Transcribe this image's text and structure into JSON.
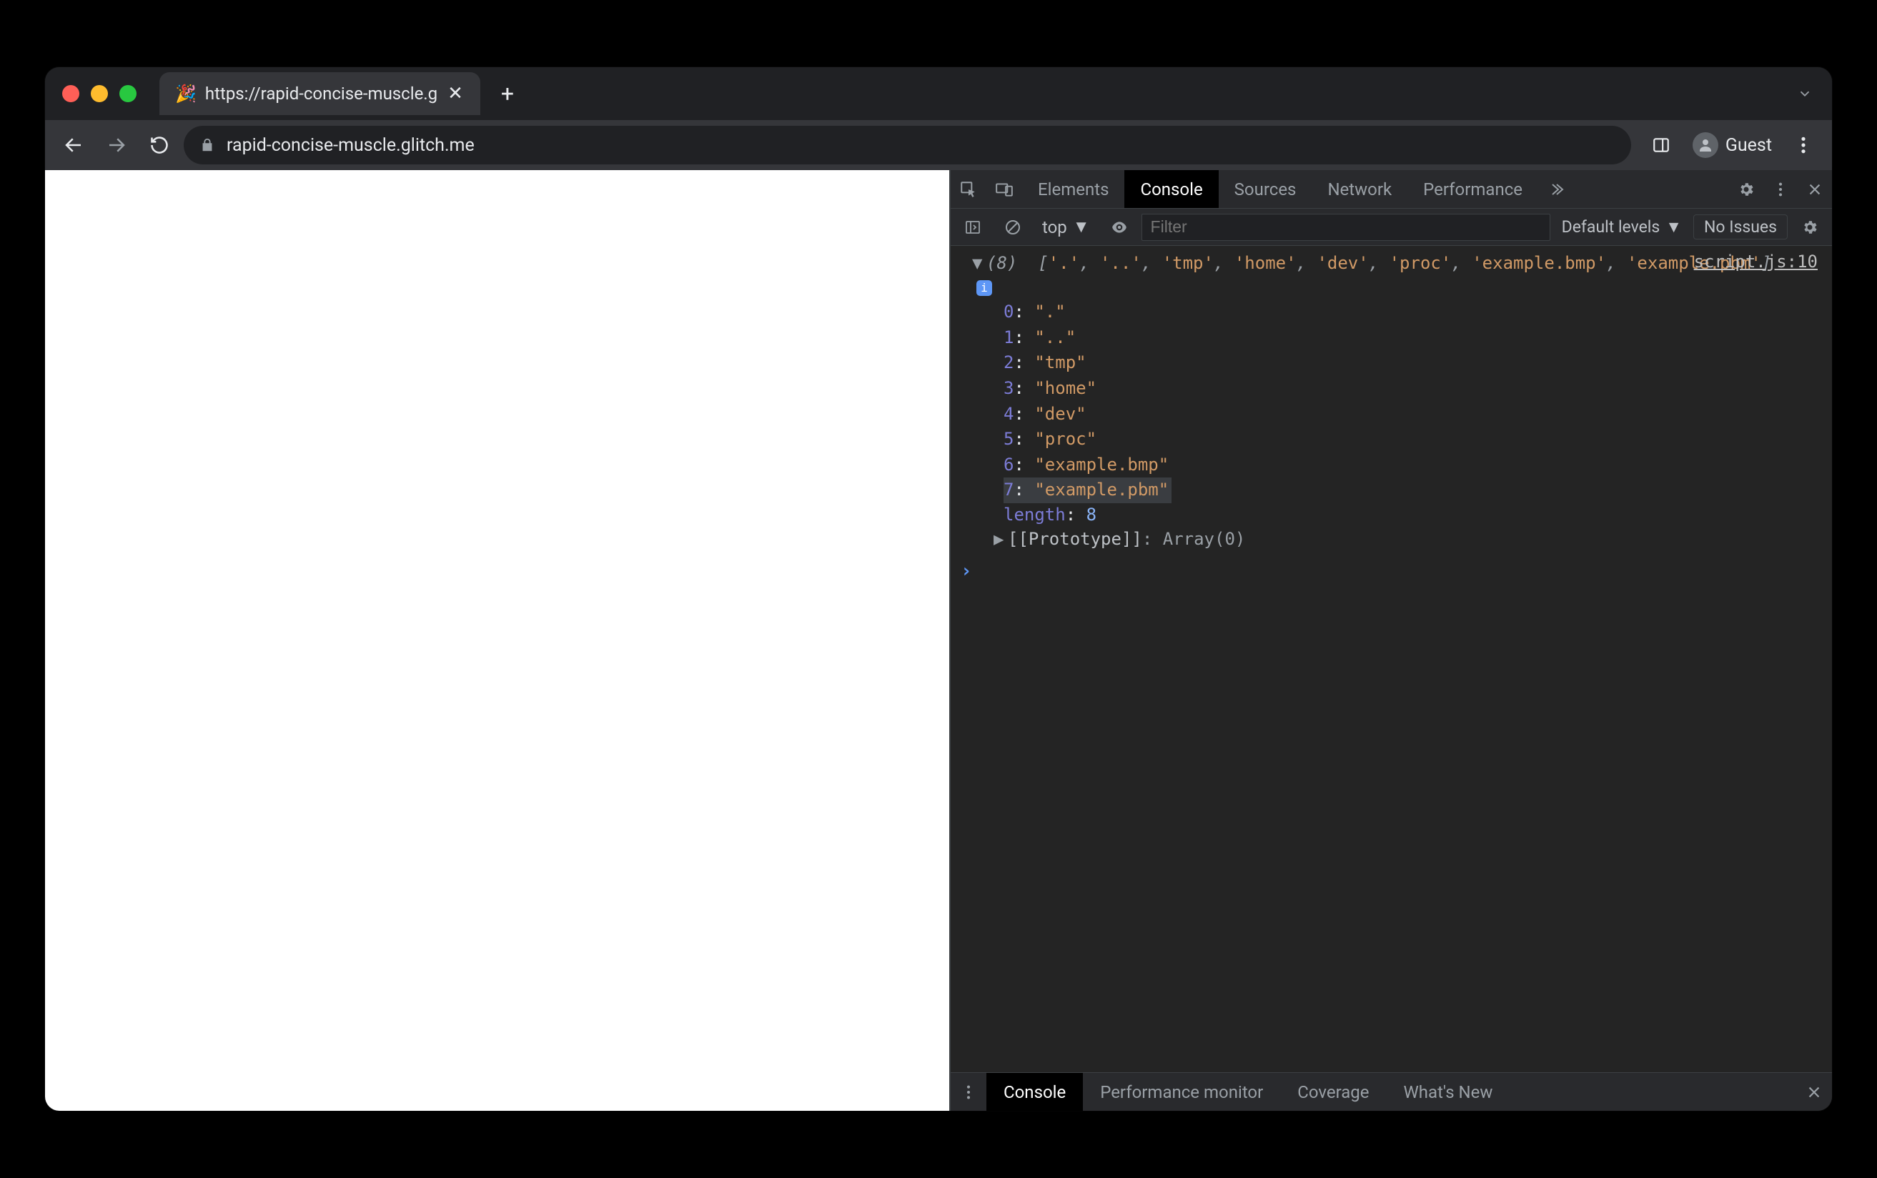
{
  "tab": {
    "favicon": "🎉",
    "title": "https://rapid-concise-muscle.g"
  },
  "toolbar": {
    "url": "rapid-concise-muscle.glitch.me",
    "guest_label": "Guest"
  },
  "devtools": {
    "tabs": {
      "elements": "Elements",
      "console": "Console",
      "sources": "Sources",
      "network": "Network",
      "performance": "Performance"
    },
    "console_toolbar": {
      "context_label": "top",
      "filter_placeholder": "Filter",
      "levels_label": "Default levels",
      "issues_label": "No Issues"
    },
    "source_link": "script.js:10",
    "array_length_label": "(8)",
    "summary_items": [
      ".",
      "..",
      "tmp",
      "home",
      "dev",
      "proc",
      "example.bmp",
      "example.pbm"
    ],
    "expanded_entries": [
      {
        "index": "0",
        "value": "\".\""
      },
      {
        "index": "1",
        "value": "\"..\""
      },
      {
        "index": "2",
        "value": "\"tmp\""
      },
      {
        "index": "3",
        "value": "\"home\""
      },
      {
        "index": "4",
        "value": "\"dev\""
      },
      {
        "index": "5",
        "value": "\"proc\""
      },
      {
        "index": "6",
        "value": "\"example.bmp\""
      },
      {
        "index": "7",
        "value": "\"example.pbm\"",
        "highlight": true
      }
    ],
    "length_key": "length",
    "length_value": "8",
    "prototype_label": "[[Prototype]]",
    "prototype_value": "Array(0)"
  },
  "drawer": {
    "tabs": {
      "console": "Console",
      "perf_monitor": "Performance monitor",
      "coverage": "Coverage",
      "whats_new": "What's New"
    }
  }
}
